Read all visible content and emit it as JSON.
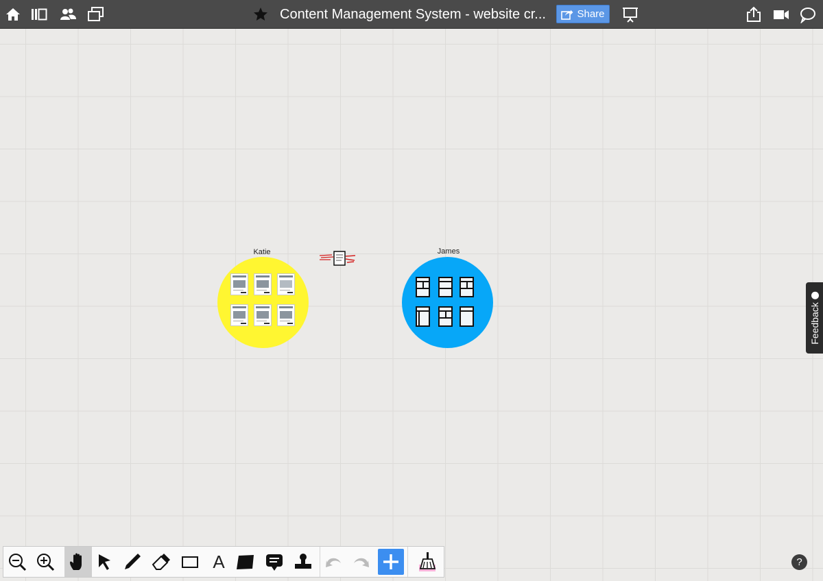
{
  "header": {
    "title": "Content Management  System - website cr...",
    "share_label": "Share",
    "icons": [
      "home-icon",
      "panel-toggle-icon",
      "people-icon",
      "windows-icon",
      "star-icon",
      "present-icon",
      "export-icon",
      "video-icon",
      "chat-icon"
    ]
  },
  "canvas": {
    "groups": [
      {
        "label": "Katie",
        "color": "#fff631",
        "thumbnails": 6
      },
      {
        "label": "James",
        "color": "#07a7f8",
        "thumbnails": 6
      }
    ]
  },
  "toolbar": {
    "tools": [
      "zoom-out-icon",
      "zoom-in-icon",
      "hand-icon",
      "select-arrow-icon",
      "pen-icon",
      "eraser-icon",
      "rectangle-icon",
      "text-icon",
      "sticky-note-icon",
      "comment-icon",
      "stamp-icon",
      "undo-icon",
      "redo-icon",
      "add-icon",
      "clear-broom-icon"
    ],
    "text_tool_label": "A",
    "active_tool": "hand"
  },
  "help": {
    "label": "?"
  },
  "feedback": {
    "label": "Feedback"
  },
  "colors": {
    "topbar": "#4a4a4a",
    "share": "#5b97e6",
    "canvas": "#ebeae8",
    "add": "#3c8ef0"
  }
}
